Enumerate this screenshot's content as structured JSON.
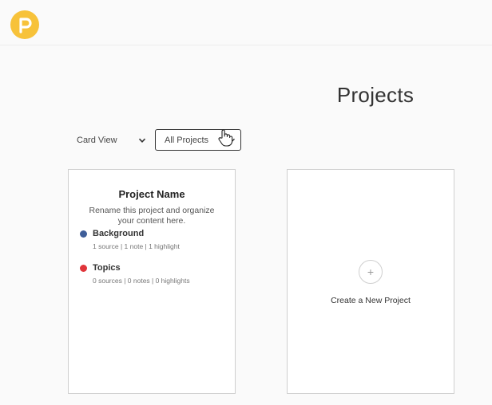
{
  "header": {
    "logo_icon": "pendo-logo-icon",
    "logo_color": "#F7C23A"
  },
  "main": {
    "title": "Projects",
    "view_select": {
      "value": "Card View"
    },
    "project_filter": {
      "value": "All Projects"
    }
  },
  "project_card": {
    "name": "Project Name",
    "description": "Rename this project and organize your content here.",
    "folders": [
      {
        "name": "Background",
        "meta": "1 source | 1 note | 1 highlight",
        "color": "#3F5E99"
      },
      {
        "name": "Topics",
        "meta": "0 sources | 0 notes | 0 highlights",
        "color": "#E0353A"
      }
    ]
  },
  "new_project_card": {
    "plus_glyph": "+",
    "label": "Create a New Project"
  }
}
